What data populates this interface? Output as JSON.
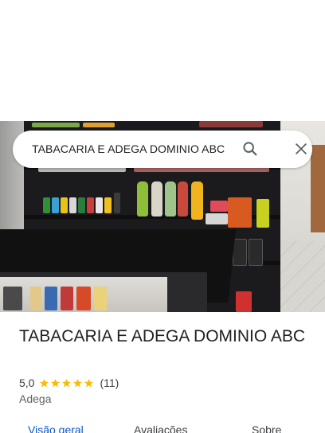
{
  "search": {
    "query": "TABACARIA E ADEGA DOMINIO ABC",
    "search_icon": "search-icon",
    "close_icon": "close-icon"
  },
  "place": {
    "name": "TABACARIA E ADEGA DOMINIO ABC",
    "rating": "5,0",
    "stars": 5,
    "reviews": "(11)",
    "category": "Adega"
  },
  "tabs": [
    {
      "label": "Visão geral",
      "active": true
    },
    {
      "label": "Avaliações",
      "active": false
    },
    {
      "label": "Sobre",
      "active": false
    }
  ],
  "colors": {
    "accent": "#0b57d0",
    "star": "#fbbc04",
    "text": "#202124",
    "secondary_text": "#5f6368"
  }
}
